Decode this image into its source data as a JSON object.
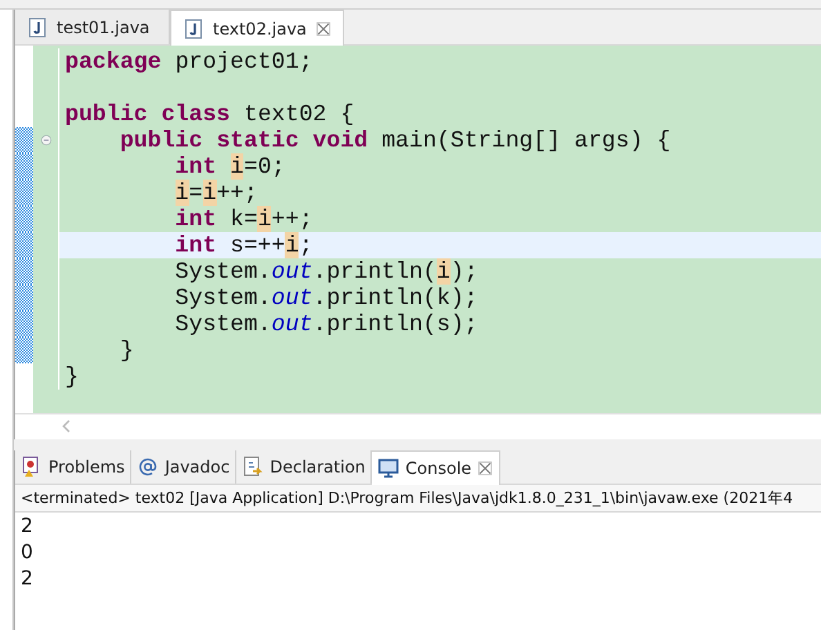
{
  "editor": {
    "tabs": [
      {
        "label": "test01.java",
        "selected": false
      },
      {
        "label": "text02.java",
        "selected": true
      }
    ],
    "lines": [
      {
        "changed": false,
        "fold": false,
        "current": false,
        "tokens": [
          {
            "kind": "keyword",
            "text": "package"
          },
          {
            "kind": "text",
            "text": " project01;"
          }
        ]
      },
      {
        "changed": false,
        "fold": false,
        "current": false
      },
      {
        "changed": false,
        "fold": false,
        "current": false,
        "tokens": [
          {
            "kind": "keyword",
            "text": "public"
          },
          {
            "kind": "keyword",
            "text": " class"
          },
          {
            "kind": "text",
            "text": " text02 {"
          }
        ]
      },
      {
        "changed": true,
        "fold": true,
        "current": false,
        "tokens": [
          {
            "kind": "keyword",
            "text": "    public"
          },
          {
            "kind": "keyword",
            "text": " static"
          },
          {
            "kind": "keyword",
            "text": " void"
          },
          {
            "kind": "text",
            "text": " main(String[] args) {"
          }
        ]
      },
      {
        "changed": true,
        "fold": false,
        "current": false,
        "tokens": [
          {
            "kind": "keyword",
            "text": "        int"
          },
          {
            "kind": "occurrence",
            "text": " i"
          },
          {
            "kind": "text",
            "text": "=0;"
          }
        ]
      },
      {
        "changed": true,
        "fold": false,
        "current": false,
        "tokens": [
          {
            "kind": "occurrence",
            "text": "        i"
          },
          {
            "kind": "text",
            "text": "="
          },
          {
            "kind": "occurrence",
            "text": "i"
          },
          {
            "kind": "text",
            "text": "++;"
          }
        ]
      },
      {
        "changed": true,
        "fold": false,
        "current": false,
        "tokens": [
          {
            "kind": "keyword",
            "text": "        int"
          },
          {
            "kind": "text",
            "text": " k="
          },
          {
            "kind": "occurrence",
            "text": "i"
          },
          {
            "kind": "text",
            "text": "++;"
          }
        ]
      },
      {
        "changed": true,
        "fold": false,
        "current": true,
        "tokens": [
          {
            "kind": "keyword",
            "text": "        int"
          },
          {
            "kind": "text",
            "text": " s=++"
          },
          {
            "kind": "occurrence",
            "text": "i"
          },
          {
            "kind": "text",
            "text": ";"
          }
        ]
      },
      {
        "changed": true,
        "fold": false,
        "current": false,
        "tokens": [
          {
            "kind": "text",
            "text": "        System."
          },
          {
            "kind": "field",
            "text": "out"
          },
          {
            "kind": "text",
            "text": ".println("
          },
          {
            "kind": "occurrence",
            "text": "i"
          },
          {
            "kind": "text",
            "text": ");"
          }
        ]
      },
      {
        "changed": true,
        "fold": false,
        "current": false,
        "tokens": [
          {
            "kind": "text",
            "text": "        System."
          },
          {
            "kind": "field",
            "text": "out"
          },
          {
            "kind": "text",
            "text": ".println(k);"
          }
        ]
      },
      {
        "changed": true,
        "fold": false,
        "current": false,
        "tokens": [
          {
            "kind": "text",
            "text": "        System."
          },
          {
            "kind": "field",
            "text": "out"
          },
          {
            "kind": "text",
            "text": ".println(s);"
          }
        ]
      },
      {
        "changed": true,
        "fold": false,
        "current": false,
        "tokens": [
          {
            "kind": "text",
            "text": "    }"
          }
        ]
      },
      {
        "changed": false,
        "fold": false,
        "current": false,
        "tokens": [
          {
            "kind": "text",
            "text": "}"
          }
        ]
      }
    ]
  },
  "views": {
    "tabs": [
      {
        "label": "Problems",
        "kind": "problems",
        "selected": false
      },
      {
        "label": "Javadoc",
        "kind": "javadoc",
        "selected": false
      },
      {
        "label": "Declaration",
        "kind": "declaration",
        "selected": false
      },
      {
        "label": "Console",
        "kind": "console",
        "selected": true
      }
    ],
    "status": "<terminated> text02 [Java Application] D:\\Program Files\\Java\\jdk1.8.0_231_1\\bin\\javaw.exe (2021年4",
    "output": [
      "2",
      "0",
      "2"
    ]
  }
}
